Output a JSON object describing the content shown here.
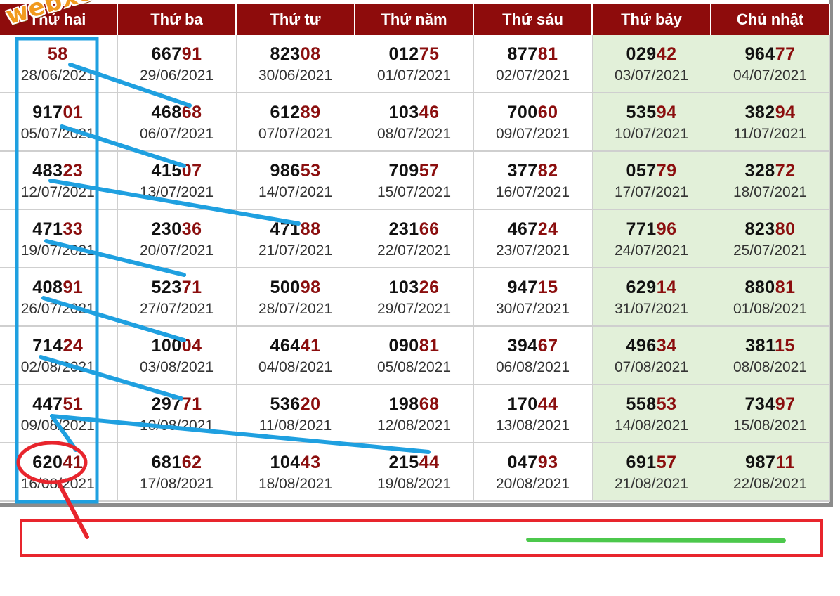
{
  "watermark": "webxoso.net",
  "headers": [
    "Thứ hai",
    "Thứ ba",
    "Thứ tư",
    "Thứ năm",
    "Thứ sáu",
    "Thứ bảy",
    "Chủ nhật"
  ],
  "weekend_color": "#e2f0d9",
  "header_color": "#8e0c0c",
  "digit_tail_color": "#8b0e0e",
  "annotation_colors": {
    "blue": "#1fa0e0",
    "red": "#e8252d",
    "green": "#4cc84c"
  },
  "rows": [
    [
      {
        "num": "",
        "tail": "58",
        "date": "28/06/2021"
      },
      {
        "num": "667",
        "tail": "91",
        "date": "29/06/2021"
      },
      {
        "num": "823",
        "tail": "08",
        "date": "30/06/2021"
      },
      {
        "num": "012",
        "tail": "75",
        "date": "01/07/2021"
      },
      {
        "num": "877",
        "tail": "81",
        "date": "02/07/2021"
      },
      {
        "num": "029",
        "tail": "42",
        "date": "03/07/2021"
      },
      {
        "num": "964",
        "tail": "77",
        "date": "04/07/2021"
      }
    ],
    [
      {
        "num": "917",
        "tail": "01",
        "date": "05/07/2021"
      },
      {
        "num": "468",
        "tail": "68",
        "date": "06/07/2021"
      },
      {
        "num": "612",
        "tail": "89",
        "date": "07/07/2021"
      },
      {
        "num": "103",
        "tail": "46",
        "date": "08/07/2021"
      },
      {
        "num": "700",
        "tail": "60",
        "date": "09/07/2021"
      },
      {
        "num": "535",
        "tail": "94",
        "date": "10/07/2021"
      },
      {
        "num": "382",
        "tail": "94",
        "date": "11/07/2021"
      }
    ],
    [
      {
        "num": "483",
        "tail": "23",
        "date": "12/07/2021"
      },
      {
        "num": "415",
        "tail": "07",
        "date": "13/07/2021"
      },
      {
        "num": "986",
        "tail": "53",
        "date": "14/07/2021"
      },
      {
        "num": "709",
        "tail": "57",
        "date": "15/07/2021"
      },
      {
        "num": "377",
        "tail": "82",
        "date": "16/07/2021"
      },
      {
        "num": "057",
        "tail": "79",
        "date": "17/07/2021"
      },
      {
        "num": "328",
        "tail": "72",
        "date": "18/07/2021"
      }
    ],
    [
      {
        "num": "471",
        "tail": "33",
        "date": "19/07/2021"
      },
      {
        "num": "230",
        "tail": "36",
        "date": "20/07/2021"
      },
      {
        "num": "471",
        "tail": "88",
        "date": "21/07/2021"
      },
      {
        "num": "231",
        "tail": "66",
        "date": "22/07/2021"
      },
      {
        "num": "467",
        "tail": "24",
        "date": "23/07/2021"
      },
      {
        "num": "771",
        "tail": "96",
        "date": "24/07/2021"
      },
      {
        "num": "823",
        "tail": "80",
        "date": "25/07/2021"
      }
    ],
    [
      {
        "num": "408",
        "tail": "91",
        "date": "26/07/2021"
      },
      {
        "num": "523",
        "tail": "71",
        "date": "27/07/2021"
      },
      {
        "num": "500",
        "tail": "98",
        "date": "28/07/2021"
      },
      {
        "num": "103",
        "tail": "26",
        "date": "29/07/2021"
      },
      {
        "num": "947",
        "tail": "15",
        "date": "30/07/2021"
      },
      {
        "num": "629",
        "tail": "14",
        "date": "31/07/2021"
      },
      {
        "num": "880",
        "tail": "81",
        "date": "01/08/2021"
      }
    ],
    [
      {
        "num": "714",
        "tail": "24",
        "date": "02/08/2021"
      },
      {
        "num": "100",
        "tail": "04",
        "date": "03/08/2021"
      },
      {
        "num": "464",
        "tail": "41",
        "date": "04/08/2021"
      },
      {
        "num": "090",
        "tail": "81",
        "date": "05/08/2021"
      },
      {
        "num": "394",
        "tail": "67",
        "date": "06/08/2021"
      },
      {
        "num": "496",
        "tail": "34",
        "date": "07/08/2021"
      },
      {
        "num": "381",
        "tail": "15",
        "date": "08/08/2021"
      }
    ],
    [
      {
        "num": "447",
        "tail": "51",
        "date": "09/08/2021"
      },
      {
        "num": "297",
        "tail": "71",
        "date": "10/08/2021"
      },
      {
        "num": "536",
        "tail": "20",
        "date": "11/08/2021"
      },
      {
        "num": "198",
        "tail": "68",
        "date": "12/08/2021"
      },
      {
        "num": "170",
        "tail": "44",
        "date": "13/08/2021"
      },
      {
        "num": "558",
        "tail": "53",
        "date": "14/08/2021"
      },
      {
        "num": "734",
        "tail": "97",
        "date": "15/08/2021"
      }
    ],
    [
      {
        "num": "620",
        "tail": "41",
        "date": "16/08/2021"
      },
      {
        "num": "681",
        "tail": "62",
        "date": "17/08/2021"
      },
      {
        "num": "104",
        "tail": "43",
        "date": "18/08/2021"
      },
      {
        "num": "215",
        "tail": "44",
        "date": "19/08/2021"
      },
      {
        "num": "047",
        "tail": "93",
        "date": "20/08/2021"
      },
      {
        "num": "691",
        "tail": "57",
        "date": "21/08/2021"
      },
      {
        "num": "987",
        "tail": "11",
        "date": "22/08/2021"
      }
    ]
  ]
}
